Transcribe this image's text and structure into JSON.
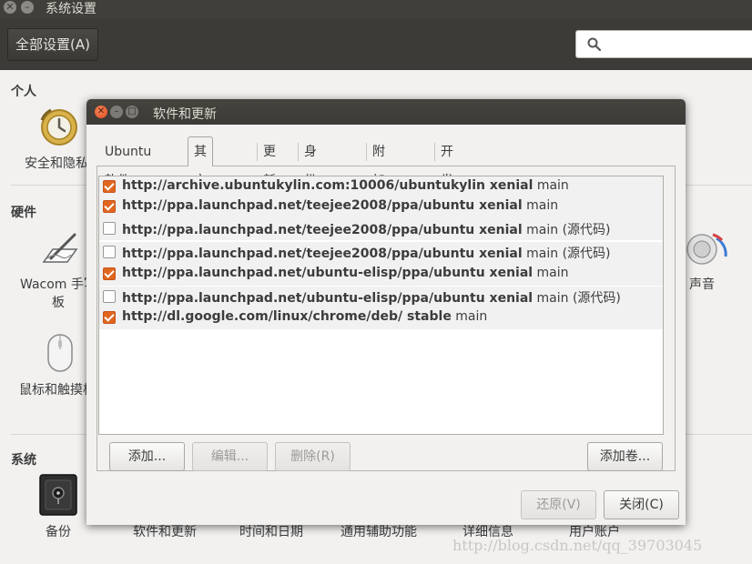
{
  "window": {
    "title": "系统设置",
    "all_settings_label": "全部设置(A)"
  },
  "sections": {
    "personal": "个人",
    "hardware": "硬件",
    "system": "系统"
  },
  "bg_items": {
    "security": "安全和隐私",
    "wacom_line1": "Wacom 手写",
    "wacom_line2": "板",
    "mouse": "鼠标和触摸板",
    "sound": "声音",
    "backup": "备份",
    "software": "软件和更新",
    "datetime": "时间和日期",
    "accessibility": "通用辅助功能",
    "details": "详细信息",
    "users": "用户账户"
  },
  "dialog": {
    "title": "软件和更新",
    "tabs": [
      "Ubuntu 软件",
      "其它软件",
      "更新",
      "身份验证",
      "附加驱动",
      "开发者选项"
    ],
    "active_tab": "其它软件",
    "sources": [
      {
        "checked": true,
        "url": "http://archive.ubuntukylin.com:10006/ubuntukylin xenial",
        "component": "main",
        "suffix": ""
      },
      {
        "checked": true,
        "url": "http://ppa.launchpad.net/teejee2008/ppa/ubuntu xenial",
        "component": "main",
        "suffix": ""
      },
      {
        "checked": false,
        "url": "http://ppa.launchpad.net/teejee2008/ppa/ubuntu xenial",
        "component": "main",
        "suffix": "(源代码)"
      },
      {
        "checked": false,
        "url": "http://ppa.launchpad.net/teejee2008/ppa/ubuntu xenial",
        "component": "main",
        "suffix": "(源代码)"
      },
      {
        "checked": true,
        "url": "http://ppa.launchpad.net/ubuntu-elisp/ppa/ubuntu xenial",
        "component": "main",
        "suffix": ""
      },
      {
        "checked": false,
        "url": "http://ppa.launchpad.net/ubuntu-elisp/ppa/ubuntu xenial",
        "component": "main",
        "suffix": "(源代码)"
      },
      {
        "checked": true,
        "url": "http://dl.google.com/linux/chrome/deb/ stable",
        "component": "main",
        "suffix": ""
      }
    ],
    "buttons": {
      "add": "添加...",
      "edit": "编辑...",
      "remove": "删除(R)",
      "add_volume": "添加卷...",
      "revert": "还原(V)",
      "close": "关闭(C)"
    }
  },
  "watermark": "http://blog.csdn.net/qq_39703045",
  "colors": {
    "accent": "#e0661f",
    "titlebar": "#3c3b37",
    "background": "#f2f1f0"
  }
}
